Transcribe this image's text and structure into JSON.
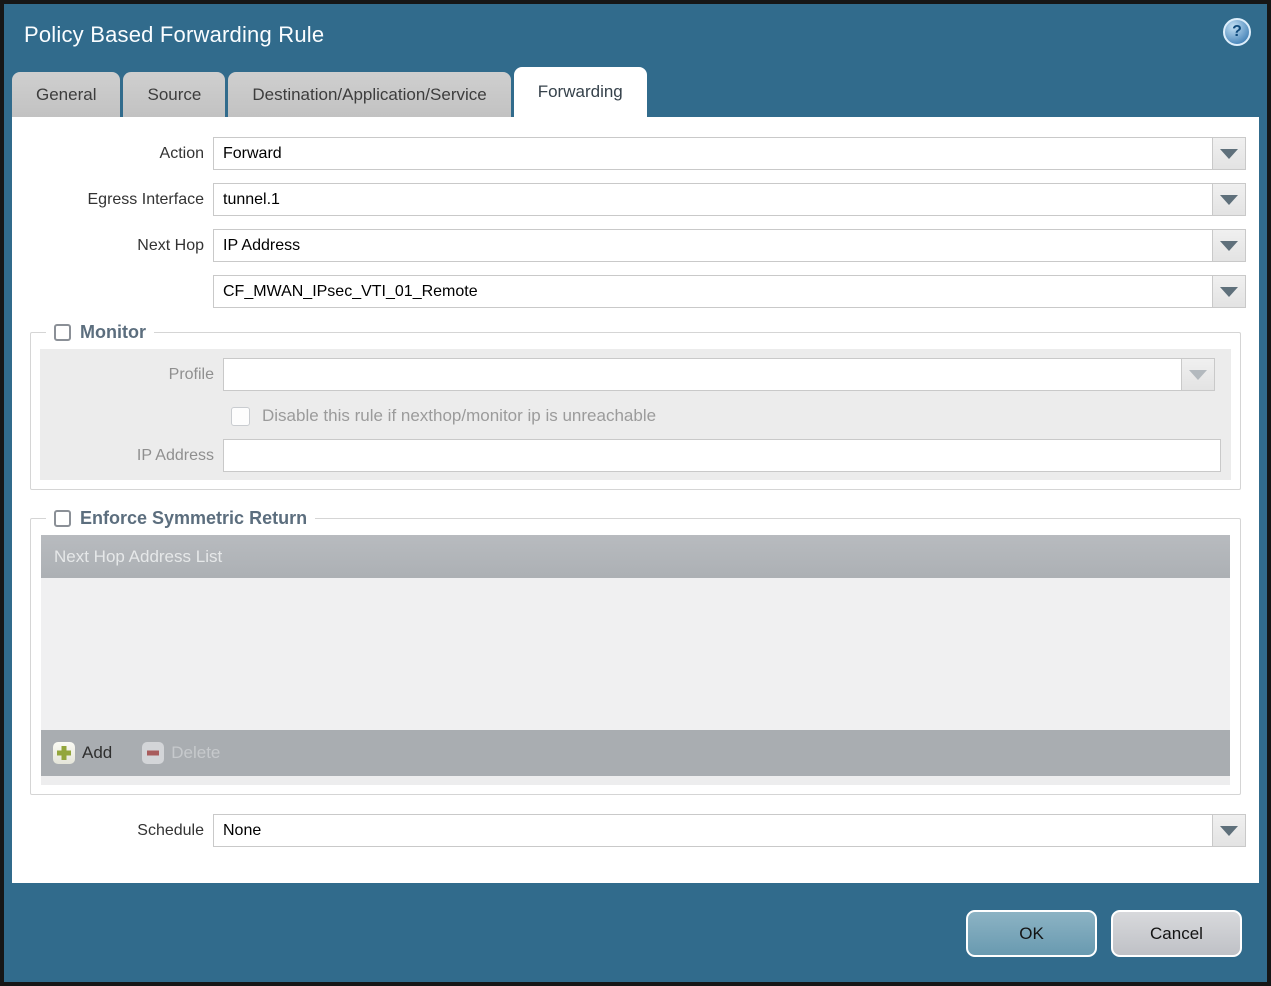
{
  "dialog": {
    "title": "Policy Based Forwarding Rule"
  },
  "icons": {
    "help": "?",
    "dropdown": "down-triangle",
    "add": "plus",
    "delete": "minus"
  },
  "tabs": [
    {
      "label": "General",
      "active": false
    },
    {
      "label": "Source",
      "active": false
    },
    {
      "label": "Destination/Application/Service",
      "active": false
    },
    {
      "label": "Forwarding",
      "active": true
    }
  ],
  "form": {
    "action": {
      "label": "Action",
      "value": "Forward"
    },
    "egress_interface": {
      "label": "Egress Interface",
      "value": "tunnel.1"
    },
    "next_hop": {
      "label": "Next Hop",
      "type_value": "IP Address",
      "address_value": "CF_MWAN_IPsec_VTI_01_Remote"
    },
    "schedule": {
      "label": "Schedule",
      "value": "None"
    }
  },
  "monitor": {
    "legend": "Monitor",
    "checked": false,
    "profile_label": "Profile",
    "profile_value": "",
    "disable_rule_label": "Disable this rule if nexthop/monitor ip is unreachable",
    "disable_rule_checked": false,
    "ip_address_label": "IP Address",
    "ip_address_value": ""
  },
  "symmetric_return": {
    "legend": "Enforce Symmetric Return",
    "checked": false,
    "table_header": "Next Hop Address List",
    "rows": [],
    "add_label": "Add",
    "delete_label": "Delete"
  },
  "footer": {
    "ok_label": "OK",
    "cancel_label": "Cancel"
  },
  "colors": {
    "chrome": "#316b8c",
    "ok_button": "#7aa6b9",
    "cancel_button": "#cbcdd0",
    "disabled_field": "#f6eedb",
    "table_header": "#b2b5b9"
  }
}
